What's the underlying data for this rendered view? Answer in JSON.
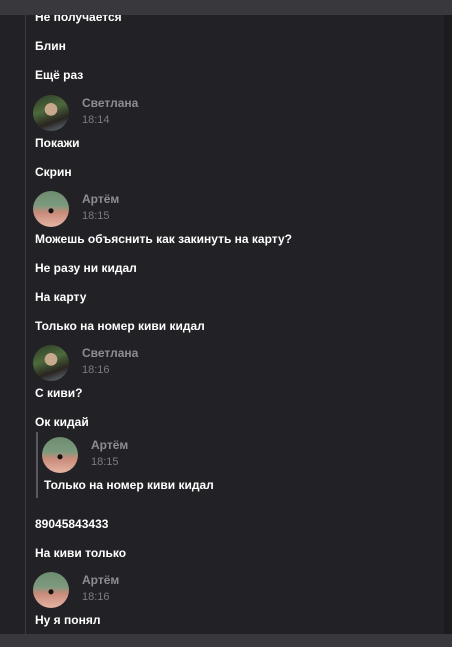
{
  "messages_top": {
    "m1": "Не получается",
    "m2": "Блин",
    "m3": "Ещё раз"
  },
  "group_svetlana_1": {
    "author": "Светлана",
    "time": "18:14",
    "m1": "Покажи",
    "m2": "Скрин"
  },
  "group_artem_1": {
    "author": "Артём",
    "time": "18:15",
    "m1": "Можешь объяснить как закинуть на карту?",
    "m2": "Не разу ни кидал",
    "m3": "На карту",
    "m4": "Только на номер киви кидал"
  },
  "group_svetlana_2": {
    "author": "Светлана",
    "time": "18:16",
    "m1": "С киви?",
    "m2": "Ок кидай",
    "quote": {
      "author": "Артём",
      "time": "18:15",
      "text": "Только на номер киви кидал"
    },
    "m3": "89045843433",
    "m4": "На киви только"
  },
  "group_artem_2": {
    "author": "Артём",
    "time": "18:16",
    "m1": "Ну я понял"
  }
}
